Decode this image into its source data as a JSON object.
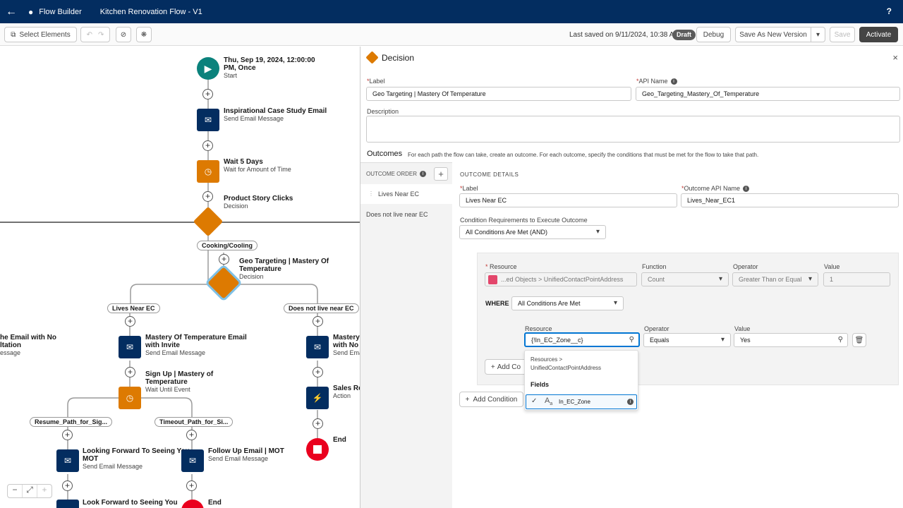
{
  "topbar": {
    "app_name": "Flow Builder",
    "flow_name": "Kitchen Renovation Flow - V1",
    "help": "?"
  },
  "toolbar": {
    "select_elements": "Select Elements",
    "last_saved": "Last saved on 9/11/2024, 10:38 AM",
    "status": "Draft",
    "debug": "Debug",
    "save_as": "Save As New Version",
    "save": "Save",
    "activate": "Activate"
  },
  "canvas": {
    "start": {
      "title1": "Thu, Sep 19, 2024, 12:00:00",
      "title2": "PM, Once",
      "sub": "Start"
    },
    "email1": {
      "title": "Inspirational Case Study Email",
      "sub": "Send Email Message"
    },
    "wait": {
      "title": "Wait 5 Days",
      "sub": "Wait for Amount of Time"
    },
    "decision1": {
      "title": "Product Story Clicks",
      "sub": "Decision",
      "branch": "Cooking/Cooling"
    },
    "decision2": {
      "title1": "Geo Targeting | Mastery Of",
      "title2": "Temperature",
      "sub": "Decision"
    },
    "branch_left": "Lives Near EC",
    "branch_right": "Does not live near EC",
    "far_left1": "he Email with No",
    "far_left2": "ltation",
    "far_left3": "essage",
    "email2": {
      "title1": "Mastery Of Temperature Email",
      "title2": "with Invite",
      "sub": "Send Email Message"
    },
    "signup": {
      "title1": "Sign Up | Mastery of",
      "title2": "Temperature",
      "sub": "Wait Until Event"
    },
    "right_email": {
      "title1": "Mastery",
      "title2": "with No I",
      "sub": "Send Ema"
    },
    "sales": {
      "title": "Sales Rep",
      "sub": "Action"
    },
    "end_right": "End",
    "resume": "Resume_Path_for_Sig...",
    "timeout": "Timeout_Path_for_Si...",
    "email3": {
      "title1": "Looking Forward To Seeing You",
      "title2": "MOT",
      "sub": "Send Email Message"
    },
    "email4": {
      "title1": "Follow Up Email | MOT",
      "sub": "Send Email Message"
    },
    "email5": "Look Forward to Seeing You",
    "end_bottom": "End"
  },
  "panel": {
    "title": "Decision",
    "label_lbl": "Label",
    "label_val": "Geo Targeting | Mastery Of Temperature",
    "api_lbl": "API Name",
    "api_val": "Geo_Targeting_Mastery_Of_Temperature",
    "desc_lbl": "Description",
    "outcomes_title": "Outcomes",
    "outcomes_help": "For each path the flow can take, create an outcome. For each outcome, specify the conditions that must be met for the flow to take that path.",
    "outcome_order": "OUTCOME ORDER",
    "outcome1": "Lives Near EC",
    "outcome2": "Does not live near EC",
    "details_title": "OUTCOME DETAILS",
    "o_label_lbl": "Label",
    "o_label_val": "Lives Near EC",
    "o_api_lbl": "Outcome API Name",
    "o_api_val": "Lives_Near_EC1",
    "cond_req_lbl": "Condition Requirements to Execute Outcome",
    "cond_req_val": "All Conditions Are Met (AND)",
    "res_lbl": "Resource",
    "res_val": "...ed Objects > UnifiedContactPointAddress",
    "func_lbl": "Function",
    "func_val": "Count",
    "op_lbl": "Operator",
    "op_val": "Greater Than or Equal",
    "value_lbl": "Value",
    "value_val": "1",
    "where": "WHERE",
    "where_val": "All Conditions Are Met",
    "inner_res_lbl": "Resource",
    "inner_res_val": "{!In_EC_Zone__c}",
    "inner_op_lbl": "Operator",
    "inner_op_val": "Equals",
    "inner_value_lbl": "Value",
    "inner_value_val": "Yes",
    "add_cond_inner": "Add Co",
    "add_cond": "Add Condition",
    "dropdown": {
      "path1": "Resources >",
      "path2": "UnifiedContactPointAddress",
      "fields": "Fields",
      "item": "In_EC_Zone"
    }
  }
}
